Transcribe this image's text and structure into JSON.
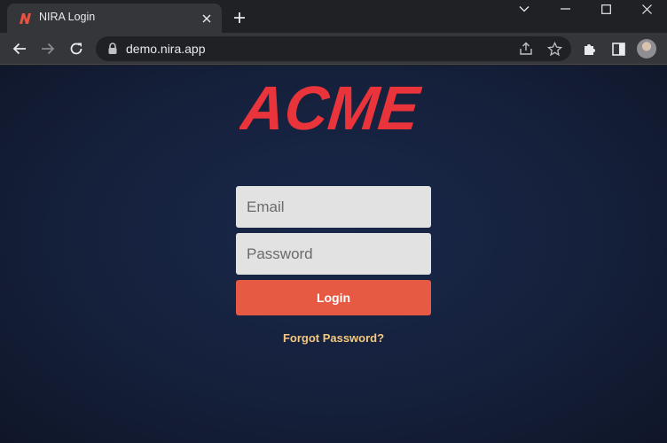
{
  "browser": {
    "tab": {
      "title": "NIRA Login",
      "favicon": "nira-logo-icon"
    },
    "address": {
      "url": "demo.nira.app"
    },
    "colors": {
      "frame": "#202124",
      "toolbar": "#35363a",
      "omnibox": "#202124"
    }
  },
  "page": {
    "logo_text": "ACME",
    "email": {
      "value": "",
      "placeholder": "Email"
    },
    "password": {
      "value": "",
      "placeholder": "Password"
    },
    "login_label": "Login",
    "forgot_label": "Forgot Password?",
    "colors": {
      "background": "#15203b",
      "logo": "#e8343a",
      "button": "#e65a43",
      "link": "#f5c87e",
      "field": "#e2e2e2"
    }
  }
}
